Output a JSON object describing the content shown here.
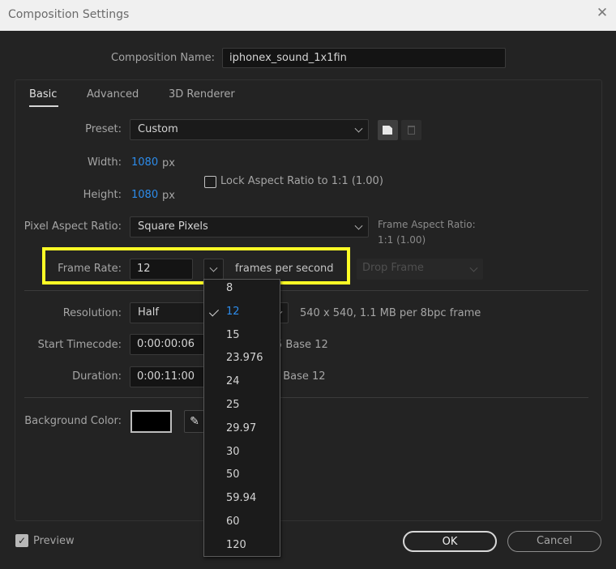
{
  "window": {
    "title": "Composition Settings",
    "close_glyph": "✕"
  },
  "comp_name": {
    "label": "Composition Name:",
    "value": "iphonex_sound_1x1fin"
  },
  "tabs": [
    {
      "label": "Basic",
      "active": true
    },
    {
      "label": "Advanced"
    },
    {
      "label": "3D Renderer"
    }
  ],
  "preset": {
    "label": "Preset:",
    "value": "Custom"
  },
  "width": {
    "label": "Width:",
    "value": "1080",
    "unit": "px"
  },
  "height": {
    "label": "Height:",
    "value": "1080",
    "unit": "px"
  },
  "lock_aspect": {
    "label": "Lock Aspect Ratio to 1:1 (1.00)",
    "checked": false
  },
  "pixel_aspect": {
    "label": "Pixel Aspect Ratio:",
    "value": "Square Pixels"
  },
  "frame_aspect": {
    "label": "Frame Aspect Ratio:",
    "value": "1:1 (1.00)"
  },
  "frame_rate": {
    "label": "Frame Rate:",
    "value": "12",
    "unit": "frames per second",
    "drop_frame": "Drop Frame",
    "options": [
      "8",
      "12",
      "15",
      "23.976",
      "24",
      "25",
      "29.97",
      "30",
      "50",
      "59.94",
      "60",
      "120"
    ],
    "selected": "12"
  },
  "resolution": {
    "label": "Resolution:",
    "value": "Half",
    "info": "540 x 540, 1.1 MB per 8bpc frame"
  },
  "start_timecode": {
    "label": "Start Timecode:",
    "value": "0:00:00:06",
    "base": "5 Base 12"
  },
  "duration": {
    "label": "Duration:",
    "value": "0:00:11:00",
    "base": ") Base 12"
  },
  "background": {
    "label": "Background Color:",
    "color": "#000000"
  },
  "preview": {
    "label": "Preview",
    "checked": true
  },
  "buttons": {
    "ok": "OK",
    "cancel": "Cancel"
  },
  "colors": {
    "accent": "#2d8ceb",
    "highlight": "#ffff26",
    "background": "#232323"
  }
}
